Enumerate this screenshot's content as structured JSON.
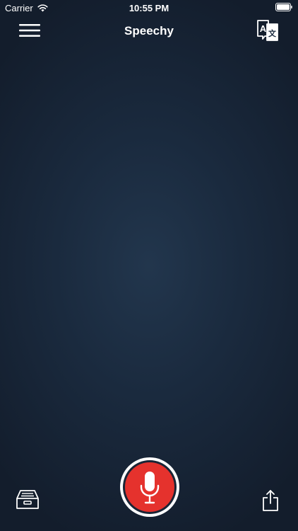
{
  "status_bar": {
    "carrier": "Carrier",
    "time": "10:55 PM",
    "icons": [
      "wifi-icon",
      "battery-icon"
    ]
  },
  "nav": {
    "title": "Speechy",
    "left_icon": "hamburger-menu-icon",
    "right_icon": "translate-icon",
    "translate_glyph": "A",
    "translate_glyph_alt": "文"
  },
  "toolbar": {
    "left_icon": "inbox-tray-icon",
    "center_icon": "microphone-icon",
    "right_icon": "share-icon"
  },
  "colors": {
    "background_center": "#22364d",
    "background_edge": "#131d2c",
    "record_red": "#e5322d",
    "foreground": "#ffffff"
  }
}
